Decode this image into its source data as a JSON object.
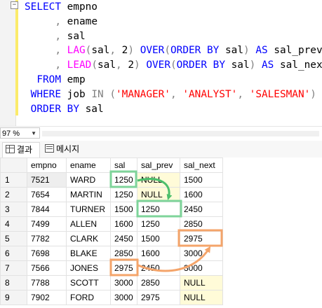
{
  "editor": {
    "collapse_symbol": "−",
    "lines": [
      [
        [
          "kw",
          "SELECT"
        ],
        [
          "txt",
          " empno"
        ]
      ],
      [
        [
          "txt",
          "     "
        ],
        [
          "gray",
          ","
        ],
        [
          "txt",
          " ename"
        ]
      ],
      [
        [
          "txt",
          "     "
        ],
        [
          "gray",
          ","
        ],
        [
          "txt",
          " sal"
        ]
      ],
      [
        [
          "txt",
          "     "
        ],
        [
          "gray",
          ","
        ],
        [
          "txt",
          " "
        ],
        [
          "fn",
          "LAG"
        ],
        [
          "gray",
          "("
        ],
        [
          "txt",
          "sal"
        ],
        [
          "gray",
          ","
        ],
        [
          "txt",
          " 2"
        ],
        [
          "gray",
          ")"
        ],
        [
          "txt",
          " "
        ],
        [
          "kw",
          "OVER"
        ],
        [
          "gray",
          "("
        ],
        [
          "kw",
          "ORDER BY"
        ],
        [
          "txt",
          " sal"
        ],
        [
          "gray",
          ")"
        ],
        [
          "txt",
          " "
        ],
        [
          "kw",
          "AS"
        ],
        [
          "txt",
          " sal_prev"
        ]
      ],
      [
        [
          "txt",
          "     "
        ],
        [
          "gray",
          ","
        ],
        [
          "txt",
          " "
        ],
        [
          "fn",
          "LEAD"
        ],
        [
          "gray",
          "("
        ],
        [
          "txt",
          "sal"
        ],
        [
          "gray",
          ","
        ],
        [
          "txt",
          " 2"
        ],
        [
          "gray",
          ")"
        ],
        [
          "txt",
          " "
        ],
        [
          "kw",
          "OVER"
        ],
        [
          "gray",
          "("
        ],
        [
          "kw",
          "ORDER BY"
        ],
        [
          "txt",
          " sal"
        ],
        [
          "gray",
          ")"
        ],
        [
          "txt",
          " "
        ],
        [
          "kw",
          "AS"
        ],
        [
          "txt",
          " sal_next"
        ]
      ],
      [
        [
          "txt",
          "  "
        ],
        [
          "kw",
          "FROM"
        ],
        [
          "txt",
          " emp"
        ]
      ],
      [
        [
          "txt",
          " "
        ],
        [
          "kw",
          "WHERE"
        ],
        [
          "txt",
          " job "
        ],
        [
          "gray",
          "IN"
        ],
        [
          "txt",
          " "
        ],
        [
          "gray",
          "("
        ],
        [
          "str",
          "'MANAGER'"
        ],
        [
          "gray",
          ","
        ],
        [
          "txt",
          " "
        ],
        [
          "str",
          "'ANALYST'"
        ],
        [
          "gray",
          ","
        ],
        [
          "txt",
          " "
        ],
        [
          "str",
          "'SALESMAN'"
        ],
        [
          "gray",
          ")"
        ]
      ],
      [
        [
          "txt",
          " "
        ],
        [
          "kw",
          "ORDER BY"
        ],
        [
          "txt",
          " sal"
        ]
      ]
    ]
  },
  "zoom": {
    "value": "97 %"
  },
  "tabs": [
    {
      "label": "결과",
      "active": true
    },
    {
      "label": "메시지",
      "active": false
    }
  ],
  "results": {
    "columns": [
      "empno",
      "ename",
      "sal",
      "sal_prev",
      "sal_next"
    ],
    "rows": [
      [
        "1",
        "7521",
        "WARD",
        "1250",
        "NULL",
        "1500"
      ],
      [
        "2",
        "7654",
        "MARTIN",
        "1250",
        "NULL",
        "1600"
      ],
      [
        "3",
        "7844",
        "TURNER",
        "1500",
        "1250",
        "2450"
      ],
      [
        "4",
        "7499",
        "ALLEN",
        "1600",
        "1250",
        "2850"
      ],
      [
        "5",
        "7782",
        "CLARK",
        "2450",
        "1500",
        "2975"
      ],
      [
        "6",
        "7698",
        "BLAKE",
        "2850",
        "1600",
        "3000"
      ],
      [
        "7",
        "7566",
        "JONES",
        "2975",
        "2450",
        "3000"
      ],
      [
        "8",
        "7788",
        "SCOTT",
        "3000",
        "2850",
        "NULL"
      ],
      [
        "9",
        "7902",
        "FORD",
        "3000",
        "2975",
        "NULL"
      ]
    ]
  },
  "colors": {
    "keyword": "#0000ff",
    "function": "#ff00ff",
    "string": "#ff0000",
    "operator": "#808080",
    "null_cell": "#fffbd8",
    "highlight_green": "#6fd18a",
    "highlight_orange": "#f4a46a"
  },
  "annotations": {
    "green_arrow": "sal 1250 (row 1) → sal_prev (row 3)",
    "orange_arrow": "sal 2975 (row 7) → sal_next (row 5)"
  }
}
